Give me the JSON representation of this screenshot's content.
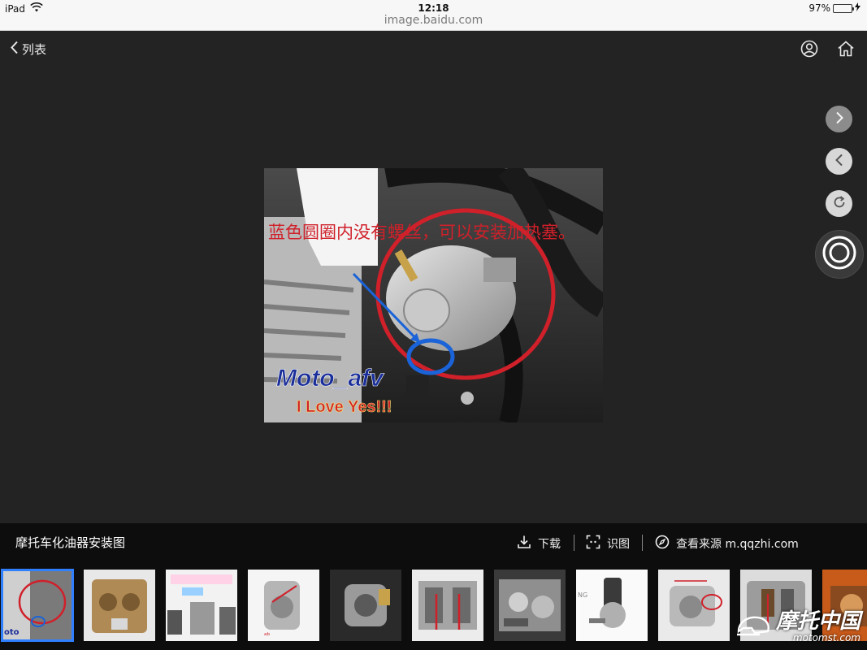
{
  "status_bar": {
    "device": "iPad",
    "time": "12:18",
    "url": "image.baidu.com",
    "battery": "97%",
    "battery_level": 0.97
  },
  "nav": {
    "back_label": "列表",
    "icons": [
      "user-icon",
      "home-icon"
    ]
  },
  "photo": {
    "annotation_text": "蓝色圆圈内没有螺丝，可以安装加热塞。",
    "logo_text": "Moto_afv",
    "tagline": "I Love Yes!!!"
  },
  "controls": [
    "next-icon",
    "prev-icon",
    "rotate-icon",
    "record-icon"
  ],
  "caption": {
    "title": "摩托车化油器安装图",
    "download_label": "下载",
    "identify_label": "识图",
    "source_label": "查看来源 m.qqzhi.com"
  },
  "thumbnails_count": 11,
  "watermark": {
    "text": "摩托中国",
    "sub": "motomst.com"
  },
  "colors": {
    "background": "#232323",
    "caption_bar": "#0d0d0d",
    "selected_outline": "#2f7fff",
    "annotation_red": "#d0202a",
    "annotation_blue": "#1a63d8"
  }
}
